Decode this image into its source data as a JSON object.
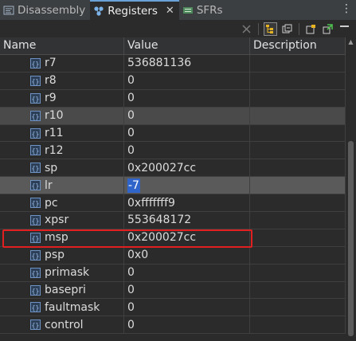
{
  "tabs": [
    {
      "label": "Disassembly",
      "icon": "disassembly-icon",
      "active": false
    },
    {
      "label": "Registers",
      "icon": "registers-icon",
      "active": true,
      "close": "✕"
    },
    {
      "label": "SFRs",
      "icon": "sfrs-icon",
      "active": false
    }
  ],
  "view_menu": "⋮",
  "table": {
    "headers": {
      "name": "Name",
      "value": "Value",
      "description": "Description"
    },
    "rows": [
      {
        "name": "r7",
        "value": "536881136"
      },
      {
        "name": "r8",
        "value": "0"
      },
      {
        "name": "r9",
        "value": "0"
      },
      {
        "name": "r10",
        "value": "0"
      },
      {
        "name": "r11",
        "value": "0"
      },
      {
        "name": "r12",
        "value": "0"
      },
      {
        "name": "sp",
        "value": "0x200027cc"
      },
      {
        "name": "lr",
        "value": "-7"
      },
      {
        "name": "pc",
        "value": "0xfffffff9"
      },
      {
        "name": "xpsr",
        "value": "553648172"
      },
      {
        "name": "msp",
        "value": "0x200027cc"
      },
      {
        "name": "psp",
        "value": "0x0"
      },
      {
        "name": "primask",
        "value": "0"
      },
      {
        "name": "basepri",
        "value": "0"
      },
      {
        "name": "faultmask",
        "value": "0"
      },
      {
        "name": "control",
        "value": "0"
      }
    ]
  },
  "colors": {
    "highlight_box": "#e02020",
    "edit_selection": "#2f65ca",
    "background": "#2b2b2b"
  }
}
